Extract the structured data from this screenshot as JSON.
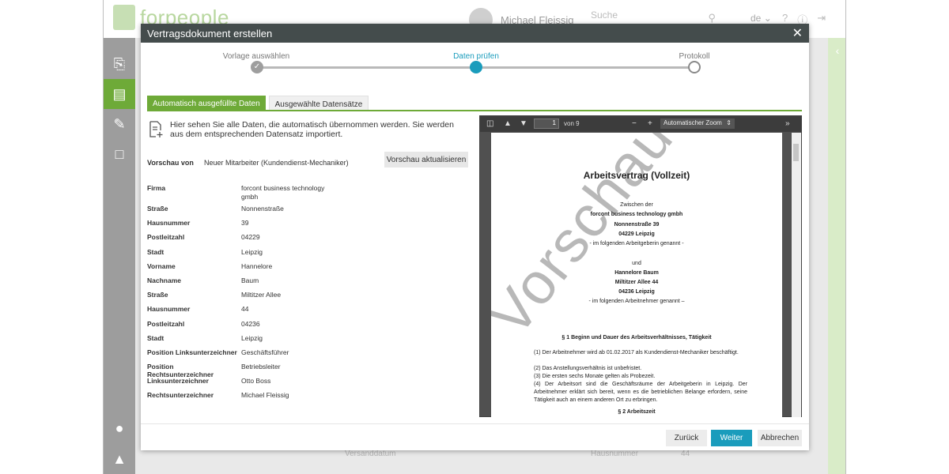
{
  "app": {
    "logo_text": "forpeople",
    "user_name": "Michael Fleissig",
    "search_placeholder": "Suche",
    "language": "de",
    "background_fields": [
      "Versanddatum",
      "Hausnummer",
      "44"
    ]
  },
  "modal": {
    "title": "Vertragsdokument erstellen",
    "steps": [
      {
        "label": "Vorlage auswählen",
        "state": "done"
      },
      {
        "label": "Daten prüfen",
        "state": "active"
      },
      {
        "label": "Protokoll",
        "state": "todo"
      }
    ],
    "tabs": [
      "Automatisch ausgefüllte Daten",
      "Ausgewählte Datensätze"
    ],
    "intro_text": "Hier sehen Sie alle Daten, die automatisch übernommen werden. Sie werden aus dem entsprechenden Datensatz importiert.",
    "preview_label": "Vorschau von",
    "preview_value": "Neuer Mitarbeiter (Kundendienst-Mechaniker)",
    "preview_button": "Vorschau aktualisieren",
    "fields": [
      {
        "label": "Firma",
        "value": "forcont business technology gmbh"
      },
      {
        "label": "Straße",
        "value": "Nonnenstraße"
      },
      {
        "label": "Hausnummer",
        "value": "39"
      },
      {
        "label": "Postleitzahl",
        "value": "04229"
      },
      {
        "label": "Stadt",
        "value": "Leipzig"
      },
      {
        "label": "Vorname",
        "value": "Hannelore"
      },
      {
        "label": "Nachname",
        "value": "Baum"
      },
      {
        "label": "Straße",
        "value": "Miltitzer Allee"
      },
      {
        "label": "Hausnummer",
        "value": "44"
      },
      {
        "label": "Postleitzahl",
        "value": "04236"
      },
      {
        "label": "Stadt",
        "value": "Leipzig"
      },
      {
        "label": "Position Linksunterzeichner",
        "value": "Geschäftsführer"
      },
      {
        "label": "Position Rechtsunterzeichner",
        "value": "Betriebsleiter"
      },
      {
        "label": "Linksunterzeichner",
        "value": "Otto Boss"
      },
      {
        "label": "Rechtsunterzeichner",
        "value": "Michael Fleissig"
      }
    ],
    "pdf": {
      "page_number": "1",
      "page_count_text": "von 9",
      "zoom_label": "Automatischer Zoom",
      "watermark": "Vorschau",
      "doc_title": "Arbeitsvertrag (Vollzeit)",
      "lines": [
        "Zwischen der",
        "forcont business technology gmbh",
        "Nonnenstraße  39",
        "04229 Leipzig",
        "- im folgenden Arbeitgeberin genannt -",
        "und",
        "Hannelore Baum",
        "Miltitzer Allee 44",
        "04236 Leipzig",
        "- im folgenden Arbeitnehmer genannt –",
        "§ 1  Beginn und Dauer des Arbeitsverhältnisses, Tätigkeit"
      ],
      "paragraphs": [
        "(1) Der Arbeitnehmer wird ab 01.02.2017 als Kundendienst-Mechaniker beschäftigt.",
        "(2) Das Anstellungsverhältnis ist unbefristet.",
        "(3) Die ersten sechs Monate gelten als Probezeit.",
        "(4) Der Arbeitsort sind die Geschäftsräume der Arbeitgeberin in Leipzig. Der Arbeitnehmer erklärt sich bereit, wenn es die betrieblichen Belange erfordern, seine Tätigkeit auch an einem anderen Ort zu erbringen."
      ],
      "section2": "§ 2 Arbeitszeit"
    },
    "buttons": {
      "back": "Zurück",
      "next": "Weiter",
      "cancel": "Abbrechen"
    }
  },
  "colors": {
    "accent_green": "#6eaa38",
    "accent_blue": "#1a9cbc",
    "header_dark": "#444c4c"
  }
}
